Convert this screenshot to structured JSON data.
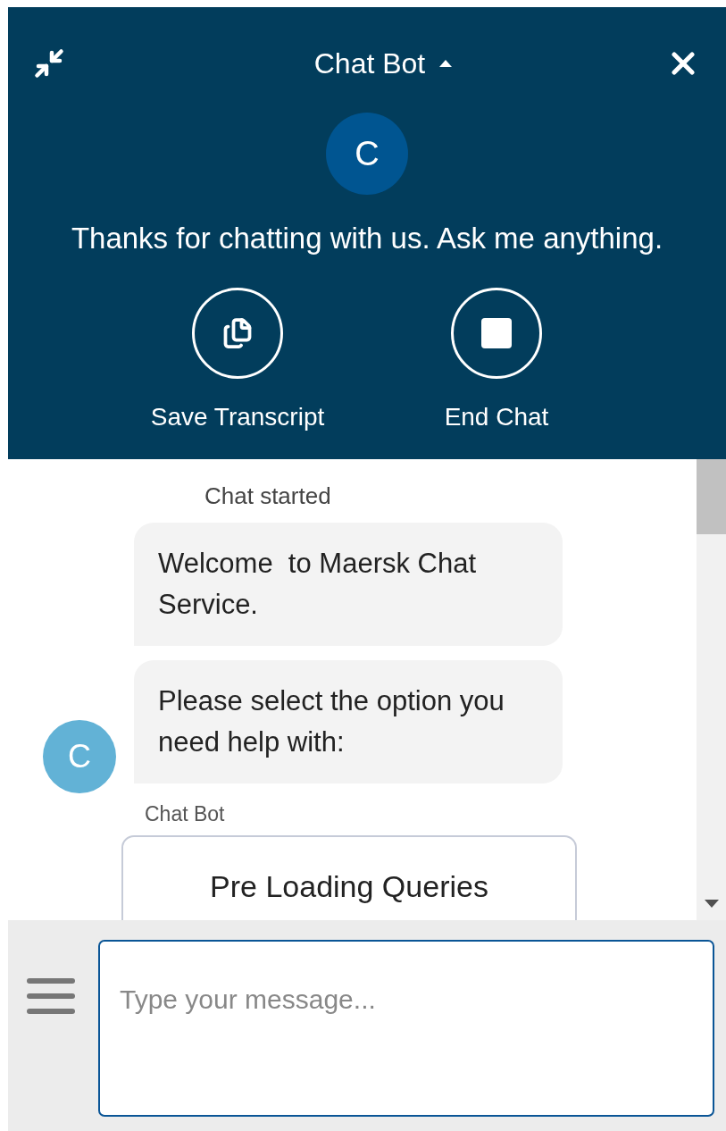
{
  "header": {
    "title": "Chat Bot",
    "avatar_letter": "C",
    "greeting": "Thanks for chatting with us. Ask me anything.",
    "actions": [
      {
        "kind": "transcript",
        "label": "Save Transcript"
      },
      {
        "kind": "end",
        "label": "End Chat"
      }
    ]
  },
  "chat": {
    "status": "Chat started",
    "messages": [
      {
        "text": "Welcome  to Maersk Chat Service."
      },
      {
        "text": "Please select the option you need help with:"
      }
    ],
    "avatar_letter": "C",
    "sender": "Chat Bot",
    "options": [
      "Pre Loading Queries"
    ]
  },
  "composer": {
    "placeholder": "Type your message..."
  }
}
